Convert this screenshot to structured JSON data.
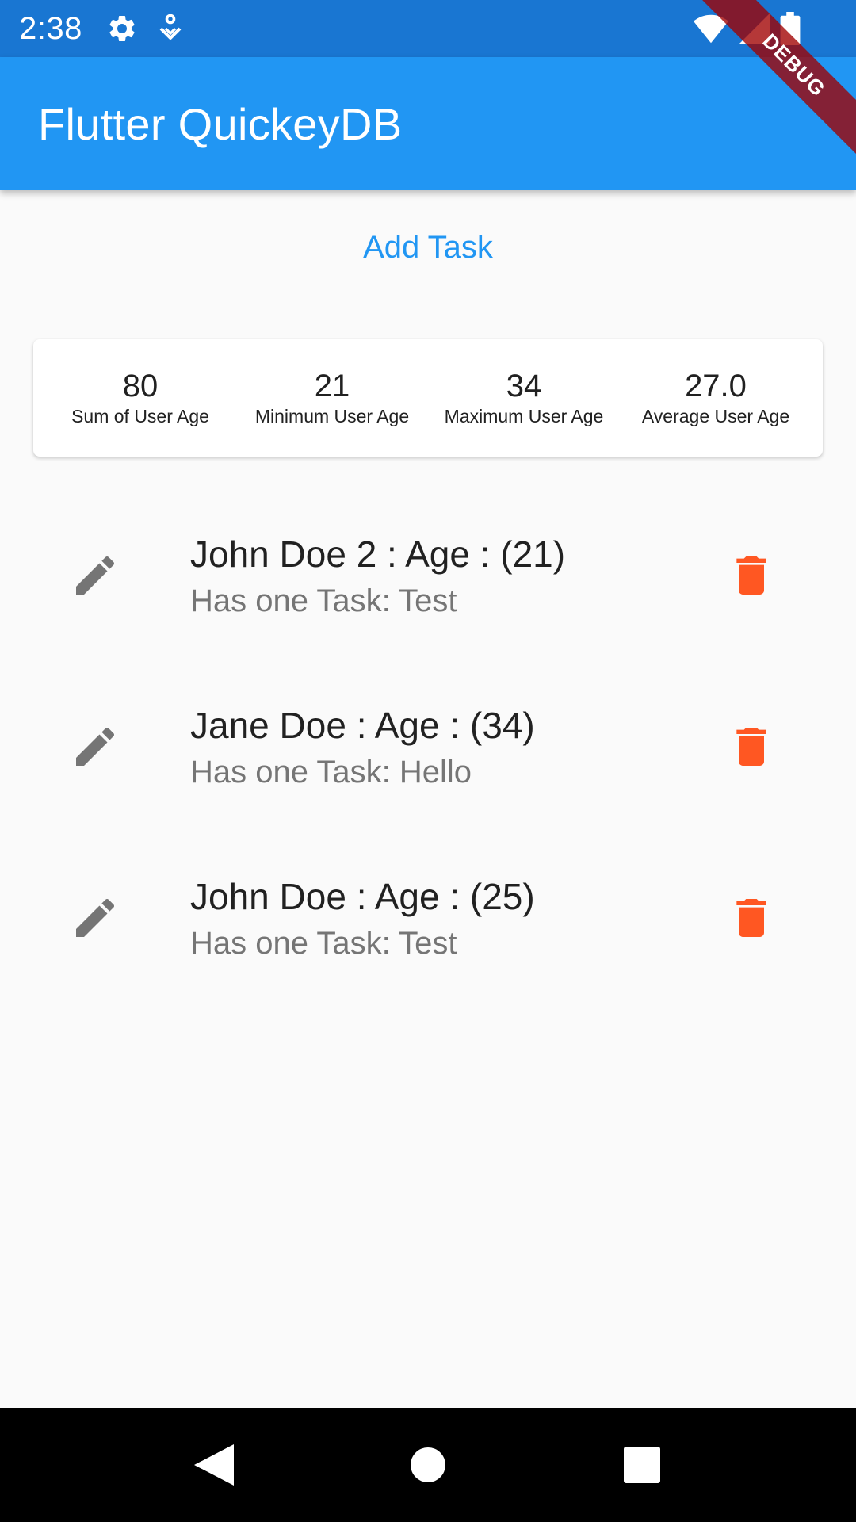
{
  "status_bar": {
    "time": "2:38",
    "left_icons": [
      "gear-icon",
      "accessibility-icon"
    ],
    "right_icons": [
      "wifi-icon",
      "signal-icon",
      "battery-icon"
    ]
  },
  "debug_banner": {
    "label": "DEBUG"
  },
  "app_bar": {
    "title": "Flutter QuickeyDB",
    "color": "#2196f3"
  },
  "actions": {
    "add_task_label": "Add Task"
  },
  "stats": [
    {
      "value": "80",
      "label": "Sum of User Age"
    },
    {
      "value": "21",
      "label": "Minimum User Age"
    },
    {
      "value": "34",
      "label": "Maximum User Age"
    },
    {
      "value": "27.0",
      "label": "Average User Age"
    }
  ],
  "users": [
    {
      "title": "John Doe 2 : Age : (21)",
      "subtitle": "Has one Task: Test"
    },
    {
      "title": "Jane Doe : Age : (34)",
      "subtitle": "Has one Task: Hello"
    },
    {
      "title": "John Doe : Age : (25)",
      "subtitle": "Has one Task: Test"
    }
  ],
  "icons": {
    "edit": "pencil-icon",
    "delete": "trash-icon"
  },
  "colors": {
    "accent": "#2196f3",
    "status_bar": "#1976d2",
    "delete": "#ff5722",
    "edit": "#757575"
  },
  "nav_bar": {
    "buttons": [
      "back-icon",
      "home-icon",
      "recents-icon"
    ]
  }
}
